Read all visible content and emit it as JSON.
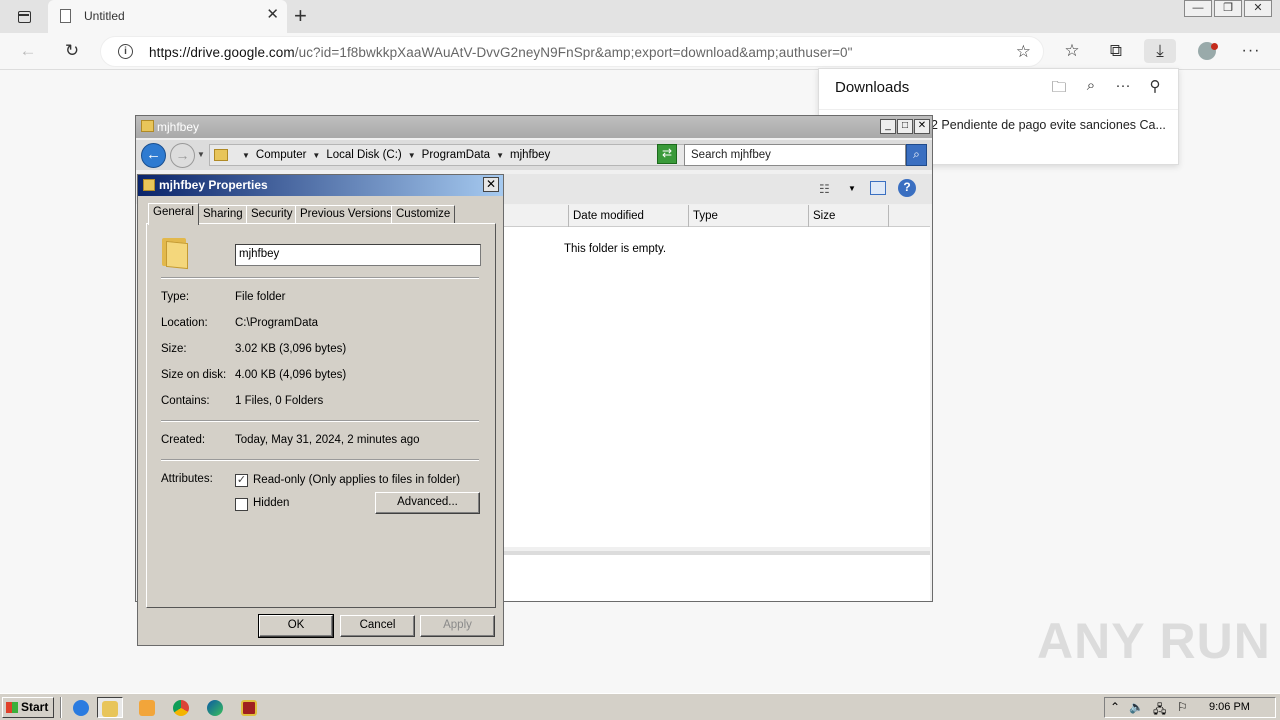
{
  "browser": {
    "tab_title": "Untitled",
    "tab_close": "✕",
    "new_tab": "+",
    "url_host": "https://drive.google.com",
    "url_rest": "/uc?id=1f8bwkkpXaaWAuAtV-DvvG2neyN9FnSpr&amp;export=download&amp;authuser=0\""
  },
  "downloads": {
    "title": "Downloads",
    "item": "2 Pendiente de pago evite sanciones Ca..."
  },
  "explorer": {
    "title": "mjhfbey",
    "breadcrumb": [
      "Computer",
      "Local Disk (C:)",
      "ProgramData",
      "mjhfbey"
    ],
    "search_placeholder": "Search mjhfbey",
    "columns": [
      "Date modified",
      "Type",
      "Size"
    ],
    "empty_message": "This folder is empty."
  },
  "properties": {
    "title": "mjhfbey Properties",
    "tabs": [
      "General",
      "Sharing",
      "Security",
      "Previous Versions",
      "Customize"
    ],
    "folder_name": "mjhfbey",
    "labels": {
      "type": "Type:",
      "location": "Location:",
      "size": "Size:",
      "size_on_disk": "Size on disk:",
      "contains": "Contains:",
      "created": "Created:",
      "attributes": "Attributes:"
    },
    "values": {
      "type": "File folder",
      "location": "C:\\ProgramData",
      "size": "3.02 KB (3,096 bytes)",
      "size_on_disk": "4.00 KB (4,096 bytes)",
      "contains": "1 Files, 0 Folders",
      "created": "Today, May 31, 2024, 2 minutes ago"
    },
    "readonly_label": "Read-only (Only applies to files in folder)",
    "readonly_checked": true,
    "hidden_label": "Hidden",
    "hidden_checked": false,
    "advanced_button": "Advanced...",
    "ok_button": "OK",
    "cancel_button": "Cancel",
    "apply_button": "Apply"
  },
  "watermark": "ANY RUN",
  "taskbar": {
    "start_label": "Start",
    "clock": "9:06 PM"
  },
  "colors": {
    "dialog_title_start": "#0a246a",
    "dialog_title_end": "#a6caf0",
    "nav_blue": "#2f7bd1",
    "folder_yellow": "#e8c55a"
  }
}
